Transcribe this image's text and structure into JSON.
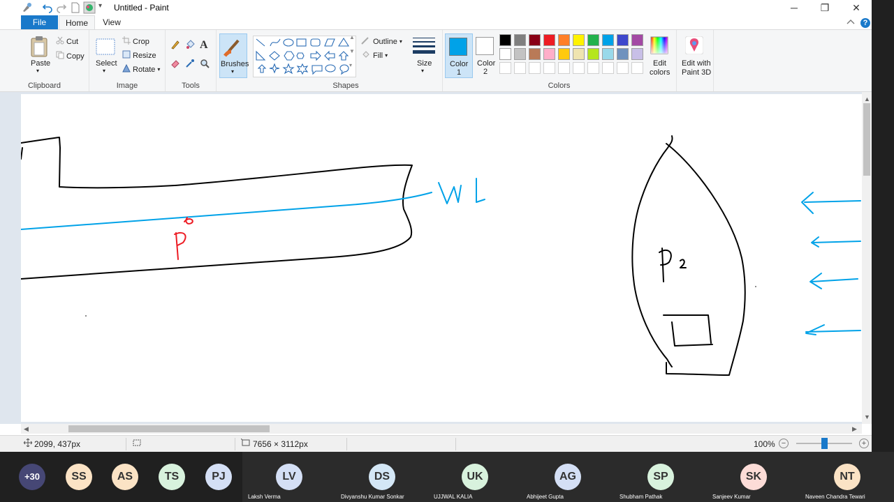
{
  "titlebar": {
    "title": "Untitled - Paint",
    "quick_access_dropdown": "▾",
    "minimize": "─",
    "maximize": "❐",
    "close": "✕"
  },
  "tabs": {
    "file": "File",
    "home": "Home",
    "view": "View",
    "help": "?"
  },
  "ribbon": {
    "clipboard": {
      "label": "Clipboard",
      "paste": "Paste",
      "cut": "Cut",
      "copy": "Copy"
    },
    "image": {
      "label": "Image",
      "select": "Select",
      "crop": "Crop",
      "resize": "Resize",
      "rotate": "Rotate"
    },
    "tools": {
      "label": "Tools"
    },
    "brushes": {
      "label": "Brushes"
    },
    "shapes": {
      "label": "Shapes",
      "outline": "Outline",
      "fill": "Fill"
    },
    "size": {
      "label": "Size"
    },
    "colors": {
      "label": "Colors",
      "color1_label": "Color",
      "color1_num": "1",
      "color2_label": "Color",
      "color2_num": "2",
      "color1_value": "#00a2e8",
      "color2_value": "#ffffff",
      "edit_colors_1": "Edit",
      "edit_colors_2": "colors",
      "edit3d_1": "Edit with",
      "edit3d_2": "Paint 3D",
      "palette_row1": [
        "#000000",
        "#7f7f7f",
        "#880015",
        "#ed1c24",
        "#ff7f27",
        "#fff200",
        "#22b14c",
        "#00a2e8",
        "#3f48cc",
        "#a349a4"
      ],
      "palette_row2": [
        "#ffffff",
        "#c3c3c3",
        "#b97a57",
        "#ffaec9",
        "#ffc90e",
        "#efe4b0",
        "#b5e61d",
        "#99d9ea",
        "#7092be",
        "#c8bfe7"
      ]
    }
  },
  "canvas": {
    "label_wl": "WL",
    "label_p": "P",
    "stroke_blue": "#00a2e8",
    "stroke_red": "#ed1c24"
  },
  "statusbar": {
    "cursor_pos": "2099, 437px",
    "image_size": "7656 × 3112px",
    "zoom": "100%",
    "zoom_out": "−",
    "zoom_in": "+"
  },
  "participants": {
    "more_count": "+30",
    "people": [
      {
        "initials": "SS",
        "name": "",
        "color": "#fbe3c5"
      },
      {
        "initials": "AS",
        "name": "",
        "color": "#fbe3c5"
      },
      {
        "initials": "TS",
        "name": "",
        "color": "#d8f2dd"
      },
      {
        "initials": "PJ",
        "name": "",
        "color": "#d4dff5"
      },
      {
        "initials": "LV",
        "name": "Laksh Verma",
        "color": "#d4dff5"
      },
      {
        "initials": "DS",
        "name": "Divyanshu Kumar Sonkar",
        "color": "#d4e7f6"
      },
      {
        "initials": "UK",
        "name": "UJJWAL KALIA",
        "color": "#d8f2dd"
      },
      {
        "initials": "AG",
        "name": "Abhijeet Gupta",
        "color": "#d4dff5"
      },
      {
        "initials": "SP",
        "name": "Shubham Pathak",
        "color": "#d8f2dd"
      },
      {
        "initials": "SK",
        "name": "Sanjeev Kumar",
        "color": "#fcdcd7"
      },
      {
        "initials": "NT",
        "name": "Naveen Chandra Tewari",
        "color": "#fbe3c5"
      }
    ]
  }
}
